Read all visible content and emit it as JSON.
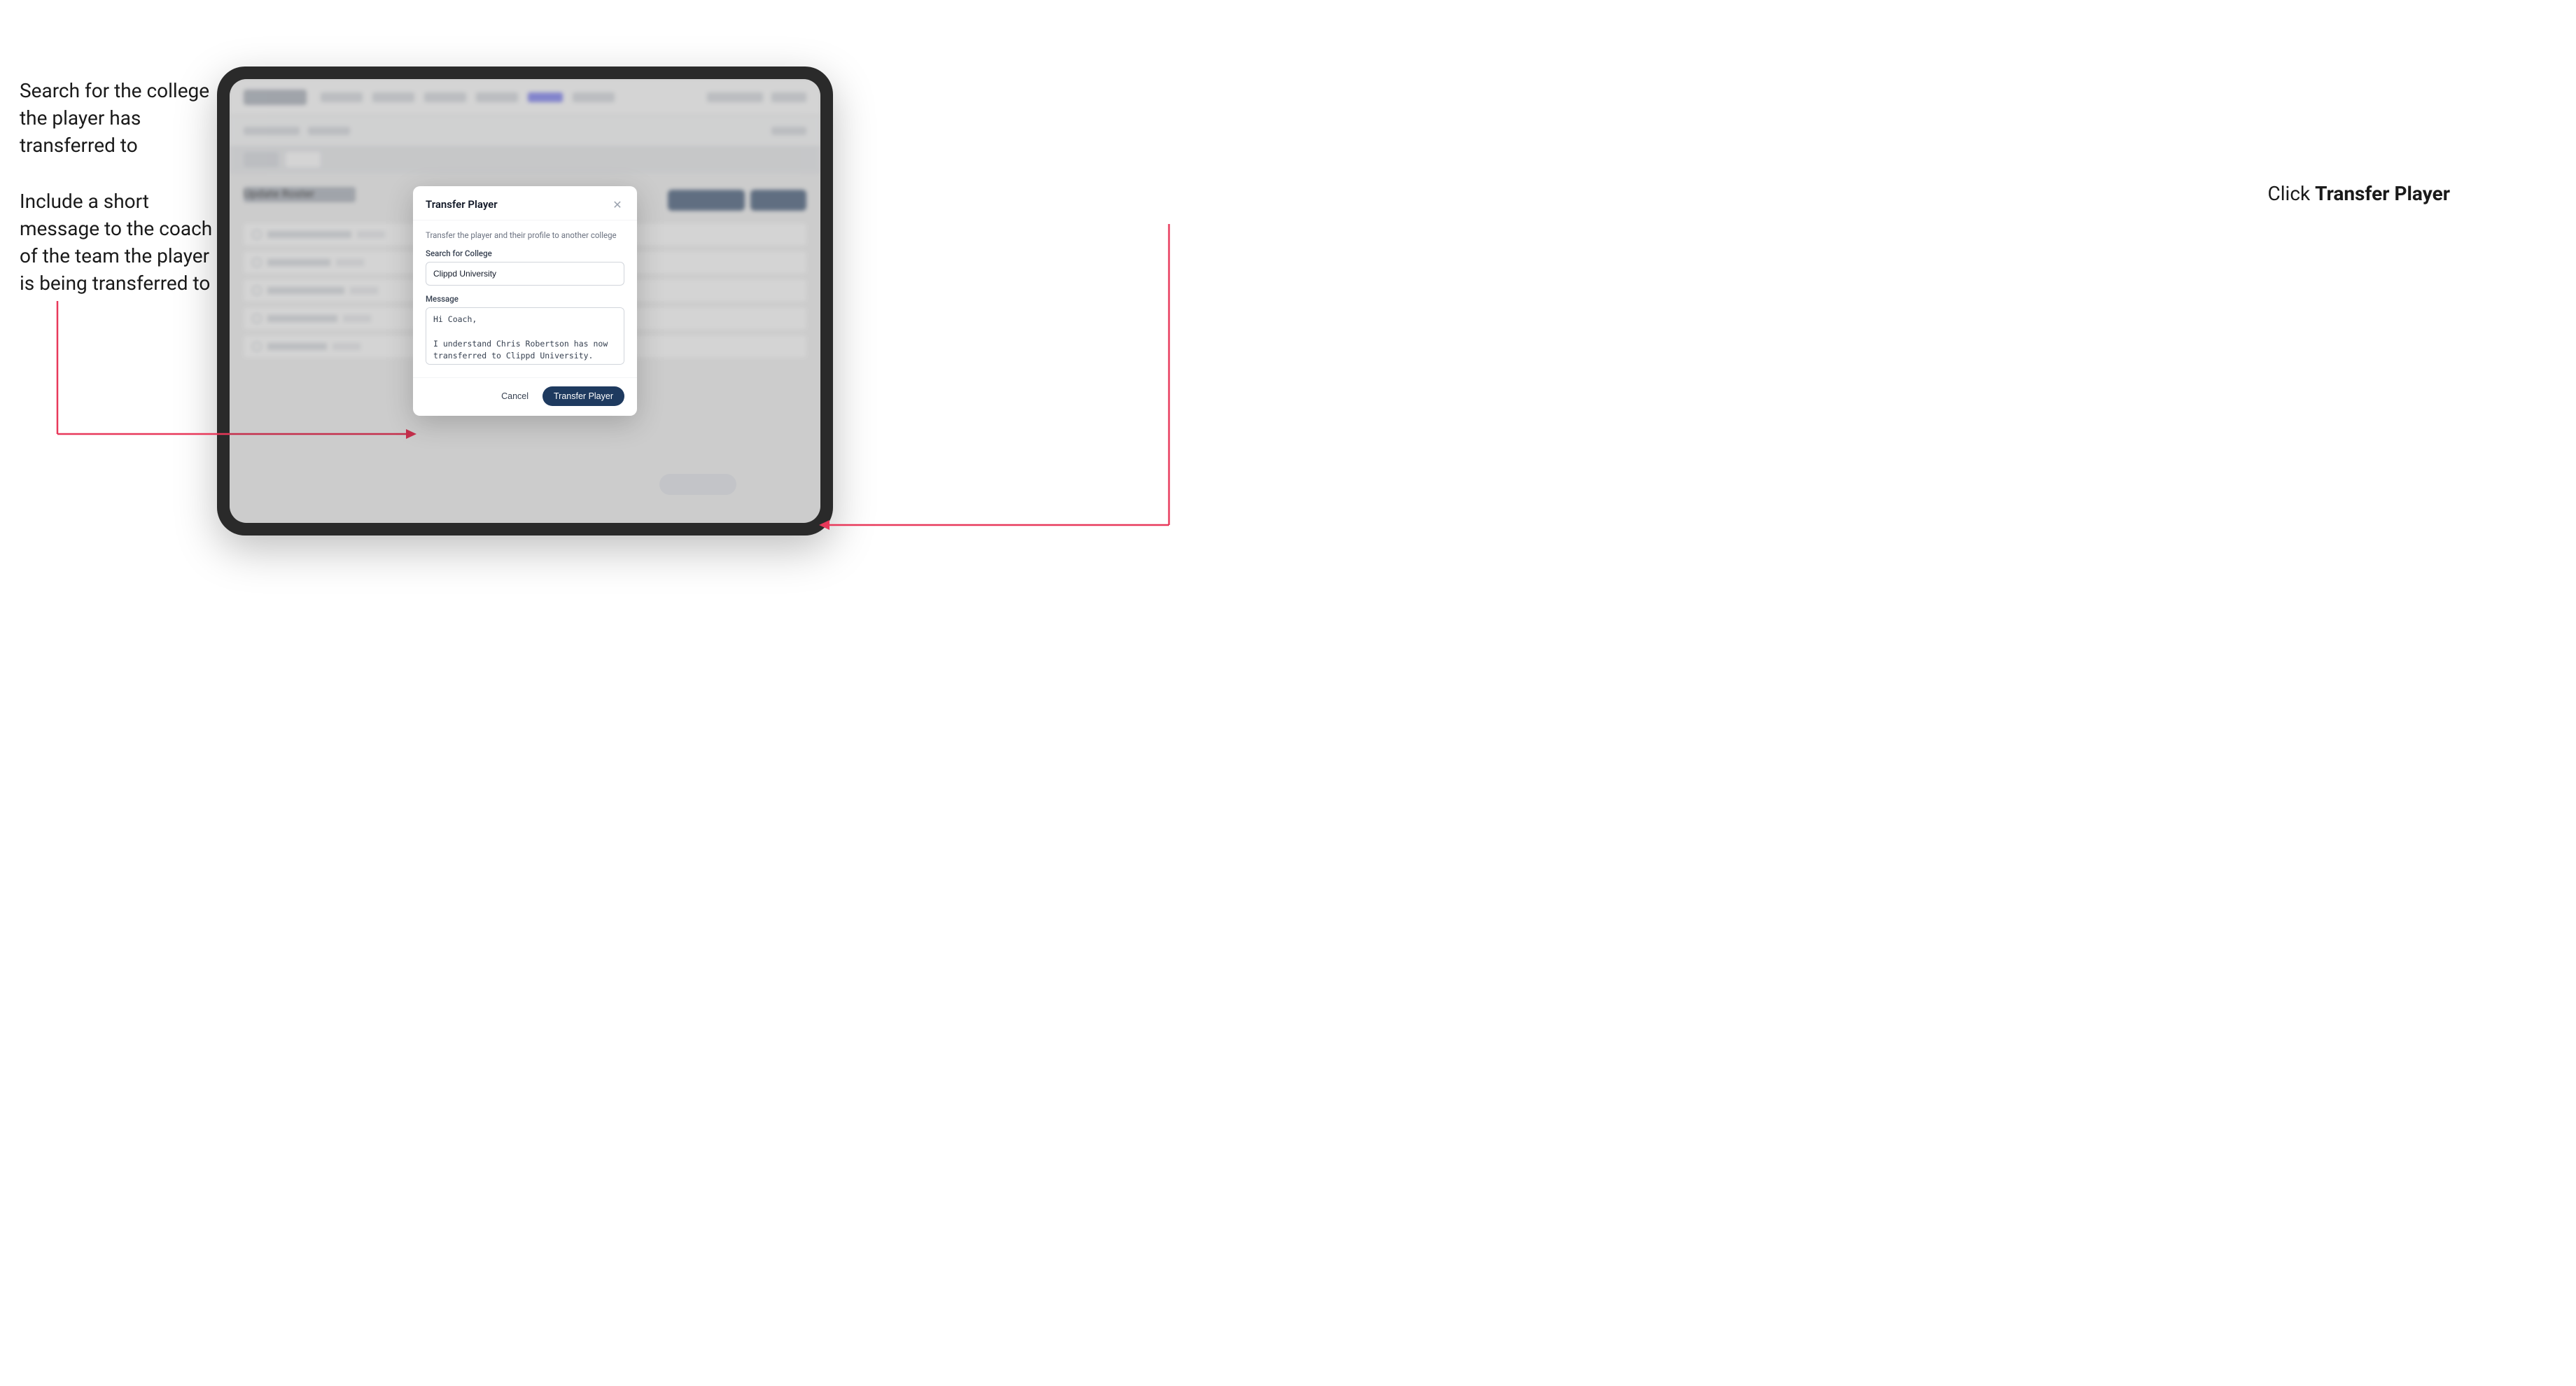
{
  "annotations": {
    "left_top": "Search for the college the player has transferred to",
    "left_bottom": "Include a short message to the coach of the team the player is being transferred to",
    "right": "Click ",
    "right_bold": "Transfer Player"
  },
  "modal": {
    "title": "Transfer Player",
    "description": "Transfer the player and their profile to another college",
    "search_label": "Search for College",
    "search_value": "Clippd University",
    "message_label": "Message",
    "message_value": "Hi Coach,\n\nI understand Chris Robertson has now transferred to Clippd University. Please accept this transfer request when you can.",
    "cancel_label": "Cancel",
    "transfer_label": "Transfer Player"
  },
  "background": {
    "update_roster": "Update Roster"
  }
}
